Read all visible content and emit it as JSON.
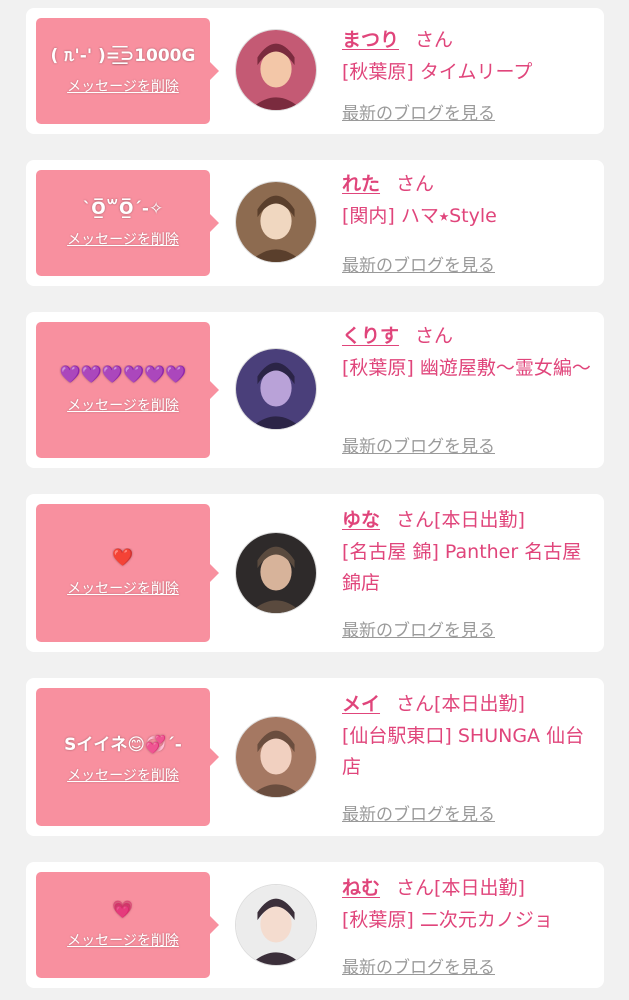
{
  "colors": {
    "accent": "#e0457b",
    "message_bg": "#f8909f",
    "link_gray": "#9a9a9a",
    "page_bg": "#f1f1f1"
  },
  "entries": [
    {
      "message": "( ᥰ'-' )=͟͟͞͞⊃1000G",
      "delete_label": "メッセージを削除",
      "avatar": "avatar-photo",
      "name": "まつり",
      "honorific": "さん",
      "status": "",
      "shop": "[秋葉原] タイムリープ",
      "blog_link": "最新のブログを見る"
    },
    {
      "message": "`O̲̅꒳O̲̅´-✧",
      "delete_label": "メッセージを削除",
      "avatar": "avatar-photo",
      "name": "れた",
      "honorific": "さん",
      "status": "",
      "shop": "[関内] ハマ⭑Style",
      "blog_link": "最新のブログを見る"
    },
    {
      "message": "💜💜💜💜💜💜",
      "delete_label": "メッセージを削除",
      "avatar": "avatar-photo",
      "name": "くりす",
      "honorific": "さん",
      "status": "",
      "shop": "[秋葉原] 幽遊屋敷〜霊女編〜",
      "blog_link": "最新のブログを見る"
    },
    {
      "message": "❤️",
      "delete_label": "メッセージを削除",
      "avatar": "avatar-photo",
      "name": "ゆな",
      "honorific": "さん",
      "status": "[本日出勤]",
      "shop": "[名古屋 錦] Panther 名古屋錦店",
      "blog_link": "最新のブログを見る"
    },
    {
      "message": "Sイイネ😊💞´-",
      "delete_label": "メッセージを削除",
      "avatar": "avatar-photo",
      "name": "メイ",
      "honorific": "さん",
      "status": "[本日出勤]",
      "shop": "[仙台駅東口] SHUNGA 仙台店",
      "blog_link": "最新のブログを見る"
    },
    {
      "message": "💗",
      "delete_label": "メッセージを削除",
      "avatar": "avatar-photo",
      "name": "ねむ",
      "honorific": "さん",
      "status": "[本日出勤]",
      "shop": "[秋葉原] 二次元カノジョ",
      "blog_link": "最新のブログを見る"
    }
  ]
}
